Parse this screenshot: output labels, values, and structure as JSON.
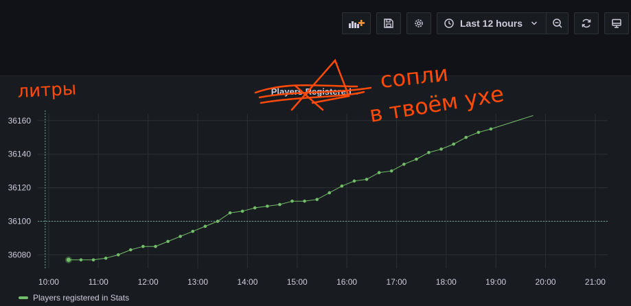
{
  "toolbar": {
    "add_panel_icon": "add-panel-icon",
    "save_icon": "save-icon",
    "settings_icon": "gear-icon",
    "time_range_label": "Last 12 hours",
    "clock_icon": "clock-icon",
    "caret_icon": "chevron-down-icon",
    "zoom_out_icon": "zoom-out-icon",
    "refresh_icon": "refresh-icon",
    "tv_mode_icon": "monitor-icon"
  },
  "panel": {
    "title": "Players Registered"
  },
  "annotations": {
    "left_scribble": "литры",
    "right_scribble_line1": "сопли",
    "right_scribble_line2": "в твоём ухе",
    "color": "#ff4a0a"
  },
  "colors": {
    "series": "#73bf69",
    "background": "#111217",
    "panel": "#181b1f",
    "grid": "#2c3035"
  },
  "chart_data": {
    "type": "line",
    "title": "Players Registered",
    "x_ticks": [
      "10:00",
      "11:00",
      "12:00",
      "13:00",
      "14:00",
      "15:00",
      "16:00",
      "17:00",
      "18:00",
      "19:00",
      "20:00",
      "21:00"
    ],
    "y_ticks": [
      36080,
      36100,
      36120,
      36140,
      36160
    ],
    "ylim": [
      36072,
      36164
    ],
    "xlim_hours": [
      9.78,
      21.25
    ],
    "grid": true,
    "legend_position": "bottom-left",
    "threshold_y": 36100,
    "cursor_x_hour": 9.93,
    "series": [
      {
        "name": "Players registered in Stats",
        "color": "#73bf69",
        "points": [
          [
            10.4,
            36077
          ],
          [
            10.65,
            36077
          ],
          [
            10.9,
            36077
          ],
          [
            11.15,
            36078
          ],
          [
            11.4,
            36080
          ],
          [
            11.65,
            36083
          ],
          [
            11.9,
            36085
          ],
          [
            12.15,
            36085
          ],
          [
            12.4,
            36088
          ],
          [
            12.65,
            36091
          ],
          [
            12.9,
            36094
          ],
          [
            13.15,
            36097
          ],
          [
            13.4,
            36100
          ],
          [
            13.65,
            36105
          ],
          [
            13.9,
            36106
          ],
          [
            14.15,
            36108
          ],
          [
            14.4,
            36109
          ],
          [
            14.65,
            36110
          ],
          [
            14.9,
            36112
          ],
          [
            15.15,
            36112
          ],
          [
            15.4,
            36113
          ],
          [
            15.65,
            36117
          ],
          [
            15.9,
            36121
          ],
          [
            16.15,
            36124
          ],
          [
            16.4,
            36125
          ],
          [
            16.65,
            36129
          ],
          [
            16.9,
            36130
          ],
          [
            17.15,
            36134
          ],
          [
            17.4,
            36137
          ],
          [
            17.65,
            36141
          ],
          [
            17.9,
            36143
          ],
          [
            18.15,
            36146
          ],
          [
            18.4,
            36150
          ],
          [
            18.65,
            36153
          ],
          [
            18.9,
            36155
          ]
        ],
        "trend_to": [
          19.75,
          36163
        ]
      }
    ]
  }
}
